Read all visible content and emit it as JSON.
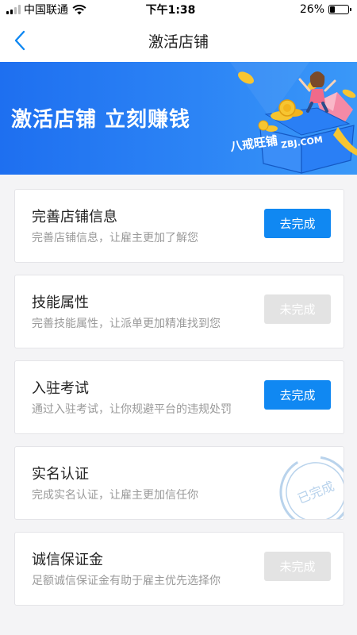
{
  "status_bar": {
    "carrier": "中国联通",
    "time": "下午1:38",
    "battery_percent": "26%",
    "battery_level": 0.26,
    "signal_bars": 4,
    "signal_filled": 2
  },
  "nav": {
    "title": "激活店铺",
    "back_icon": "chevron-left-icon"
  },
  "banner": {
    "headline": "激活店铺 立刻赚钱",
    "box_label": "八戒旺铺",
    "box_site": "ZBJ.COM",
    "colors": {
      "start": "#1e6ff0",
      "end": "#3a98f8",
      "gold": "#f7c531",
      "pink": "#f48aa6"
    }
  },
  "tasks": [
    {
      "title": "完善店铺信息",
      "desc": "完善店铺信息，让雇主更加了解您",
      "action": "去完成",
      "state": "go"
    },
    {
      "title": "技能属性",
      "desc": "完善技能属性，让派单更加精准找到您",
      "action": "未完成",
      "state": "todo"
    },
    {
      "title": "入驻考试",
      "desc": "通过入驻考试，让你规避平台的违规处罚",
      "action": "去完成",
      "state": "go"
    },
    {
      "title": "实名认证",
      "desc": "完成实名认证，让雇主更加信任你",
      "action": "已完成",
      "state": "done"
    },
    {
      "title": "诚信保证金",
      "desc": "足额诚信保证金有助于雇主优先选择你",
      "action": "未完成",
      "state": "todo"
    }
  ],
  "colors": {
    "primary": "#1088f2",
    "disabled": "#e3e3e3",
    "stamp": "#b9d3ec"
  }
}
